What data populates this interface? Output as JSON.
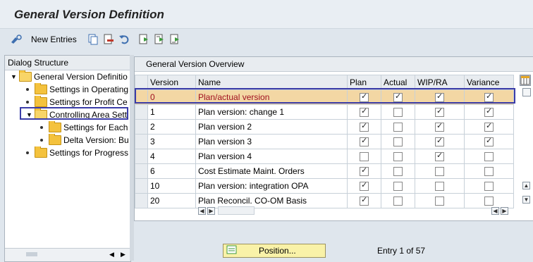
{
  "title": "General Version Definition",
  "toolbar": {
    "new_entries": "New Entries"
  },
  "dialog_structure": {
    "header": "Dialog Structure",
    "nodes": [
      {
        "label": "General Version Definitio"
      },
      {
        "label": "Settings in Operating"
      },
      {
        "label": "Settings for Profit Ce"
      },
      {
        "label": "Controlling Area Sett"
      },
      {
        "label": "Settings for Each"
      },
      {
        "label": "Delta Version: Bu"
      },
      {
        "label": "Settings for Progress"
      }
    ]
  },
  "overview": {
    "title": "General Version Overview",
    "columns": [
      "Version",
      "Name",
      "Plan",
      "Actual",
      "WIP/RA",
      "Variance"
    ],
    "rows": [
      {
        "version": "0",
        "name": "Plan/actual version",
        "plan": true,
        "actual": true,
        "wip": true,
        "variance": true
      },
      {
        "version": "1",
        "name": "Plan version: change 1",
        "plan": true,
        "actual": false,
        "wip": true,
        "variance": true
      },
      {
        "version": "2",
        "name": "Plan version 2",
        "plan": true,
        "actual": false,
        "wip": true,
        "variance": true
      },
      {
        "version": "3",
        "name": "Plan version 3",
        "plan": true,
        "actual": false,
        "wip": true,
        "variance": true
      },
      {
        "version": "4",
        "name": "Plan version 4",
        "plan": false,
        "actual": false,
        "wip": true,
        "variance": false
      },
      {
        "version": "6",
        "name": "Cost Estimate Maint. Orders",
        "plan": true,
        "actual": false,
        "wip": false,
        "variance": false
      },
      {
        "version": "10",
        "name": "Plan version: integration OPA",
        "plan": true,
        "actual": false,
        "wip": false,
        "variance": false
      },
      {
        "version": "20",
        "name": "Plan Reconcil. CO-OM Basis",
        "plan": true,
        "actual": false,
        "wip": false,
        "variance": false
      }
    ]
  },
  "position_button": "Position...",
  "entry_text": "Entry 1 of 57",
  "colors": {
    "highlight_row": "#f3d7a4",
    "selection_frame": "#3a3ca8"
  }
}
